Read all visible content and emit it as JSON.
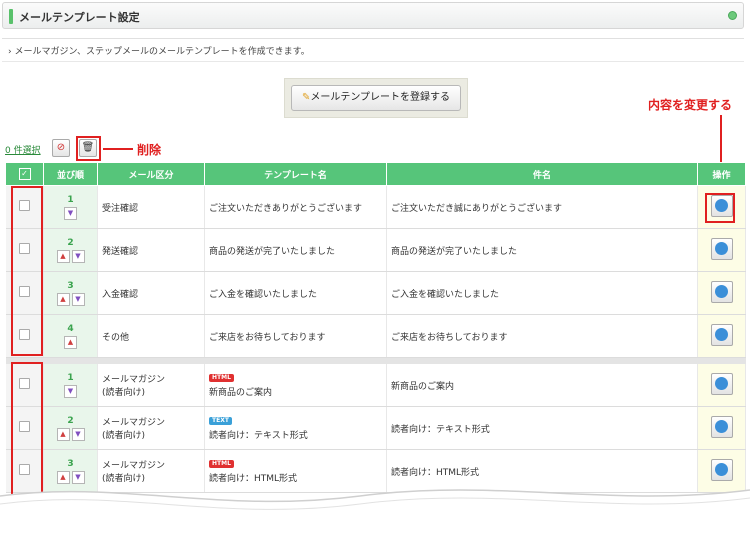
{
  "header": {
    "title": "メールテンプレート設定"
  },
  "description": "メールマガジン、ステップメールのメールテンプレートを作成できます。",
  "register_button": "メールテンプレートを登録する",
  "selection": {
    "count_label": "0 件選択"
  },
  "annotations": {
    "delete": "削除",
    "edit": "内容を変更する"
  },
  "table": {
    "headers": {
      "order": "並び順",
      "category": "メール区分",
      "template": "テンプレート名",
      "subject": "件名",
      "operation": "操作"
    },
    "group1": [
      {
        "order": "1",
        "category": "受注確認",
        "template": "ご注文いただきありがとうございます",
        "subject": "ご注文いただき誠にありがとうございます"
      },
      {
        "order": "2",
        "category": "発送確認",
        "template": "商品の発送が完了いたしました",
        "subject": "商品の発送が完了いたしました"
      },
      {
        "order": "3",
        "category": "入金確認",
        "template": "ご入金を確認いたしました",
        "subject": "ご入金を確認いたしました"
      },
      {
        "order": "4",
        "category": "その他",
        "template": "ご来店をお待ちしております",
        "subject": "ご来店をお待ちしております"
      }
    ],
    "group2": [
      {
        "order": "1",
        "category_line1": "メールマガジン",
        "category_line2": "(読者向け)",
        "badge": "HTML",
        "template": "新商品のご案内",
        "subject": "新商品のご案内"
      },
      {
        "order": "2",
        "category_line1": "メールマガジン",
        "category_line2": "(読者向け)",
        "badge": "TEXT",
        "template": "読者向け：テキスト形式",
        "subject": "読者向け：テキスト形式"
      },
      {
        "order": "3",
        "category_line1": "メールマガジン",
        "category_line2": "(読者向け)",
        "badge": "HTML",
        "template": "読者向け：HTML形式",
        "subject": "読者向け：HTML形式"
      }
    ]
  },
  "colors": {
    "accent": "#56c57a",
    "annotation": "#e02020"
  }
}
